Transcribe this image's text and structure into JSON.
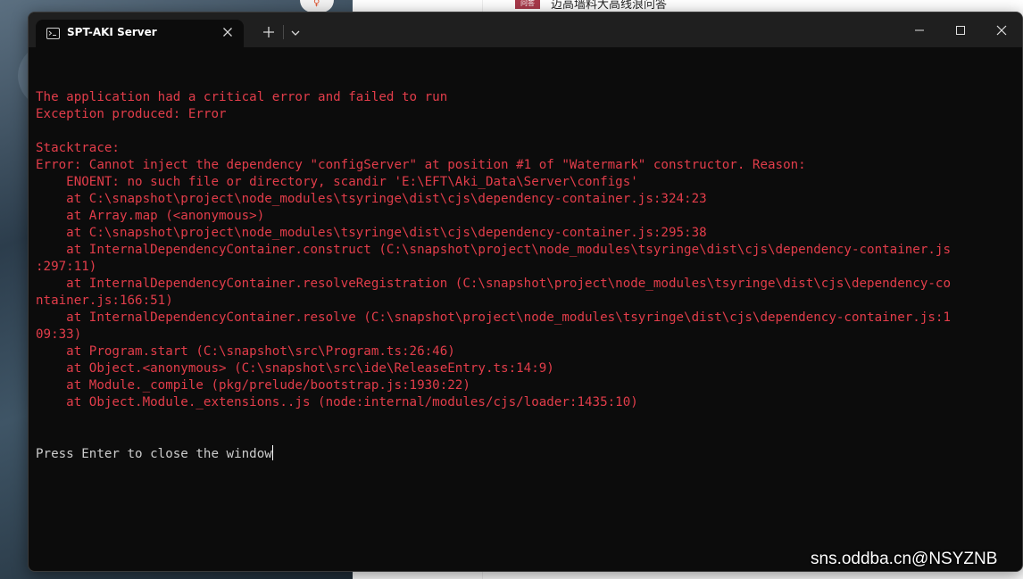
{
  "background": {
    "avatar_glyph": "♀",
    "page_thumb_label": "问答",
    "page_title": "迈高墙料大高线浪问答"
  },
  "window": {
    "tab_title": "SPT-AKI Server",
    "tab_icon": "terminal-icon",
    "new_tab_icon": "plus-icon",
    "dropdown_icon": "chevron-down-icon",
    "minimize_icon": "minimize-icon",
    "maximize_icon": "maximize-icon",
    "close_icon": "close-icon"
  },
  "terminal": {
    "lines": [
      "The application had a critical error and failed to run",
      "Exception produced: Error",
      "",
      "Stacktrace:",
      "Error: Cannot inject the dependency \"configServer\" at position #1 of \"Watermark\" constructor. Reason:",
      "    ENOENT: no such file or directory, scandir 'E:\\EFT\\Aki_Data\\Server\\configs'",
      "    at C:\\snapshot\\project\\node_modules\\tsyringe\\dist\\cjs\\dependency-container.js:324:23",
      "    at Array.map (<anonymous>)",
      "    at C:\\snapshot\\project\\node_modules\\tsyringe\\dist\\cjs\\dependency-container.js:295:38",
      "    at InternalDependencyContainer.construct (C:\\snapshot\\project\\node_modules\\tsyringe\\dist\\cjs\\dependency-container.js",
      ":297:11)",
      "    at InternalDependencyContainer.resolveRegistration (C:\\snapshot\\project\\node_modules\\tsyringe\\dist\\cjs\\dependency-co",
      "ntainer.js:166:51)",
      "    at InternalDependencyContainer.resolve (C:\\snapshot\\project\\node_modules\\tsyringe\\dist\\cjs\\dependency-container.js:1",
      "09:33)",
      "    at Program.start (C:\\snapshot\\src\\Program.ts:26:46)",
      "    at Object.<anonymous> (C:\\snapshot\\src\\ide\\ReleaseEntry.ts:14:9)",
      "    at Module._compile (pkg/prelude/bootstrap.js:1930:22)",
      "    at Object.Module._extensions..js (node:internal/modules/cjs/loader:1435:10)"
    ],
    "prompt": "Press Enter to close the window",
    "error_color": "#e23d4a",
    "text_color": "#cccccc",
    "background_color": "#0c0c0c"
  },
  "watermark": {
    "text": "sns.oddba.cn@NSYZNB"
  }
}
